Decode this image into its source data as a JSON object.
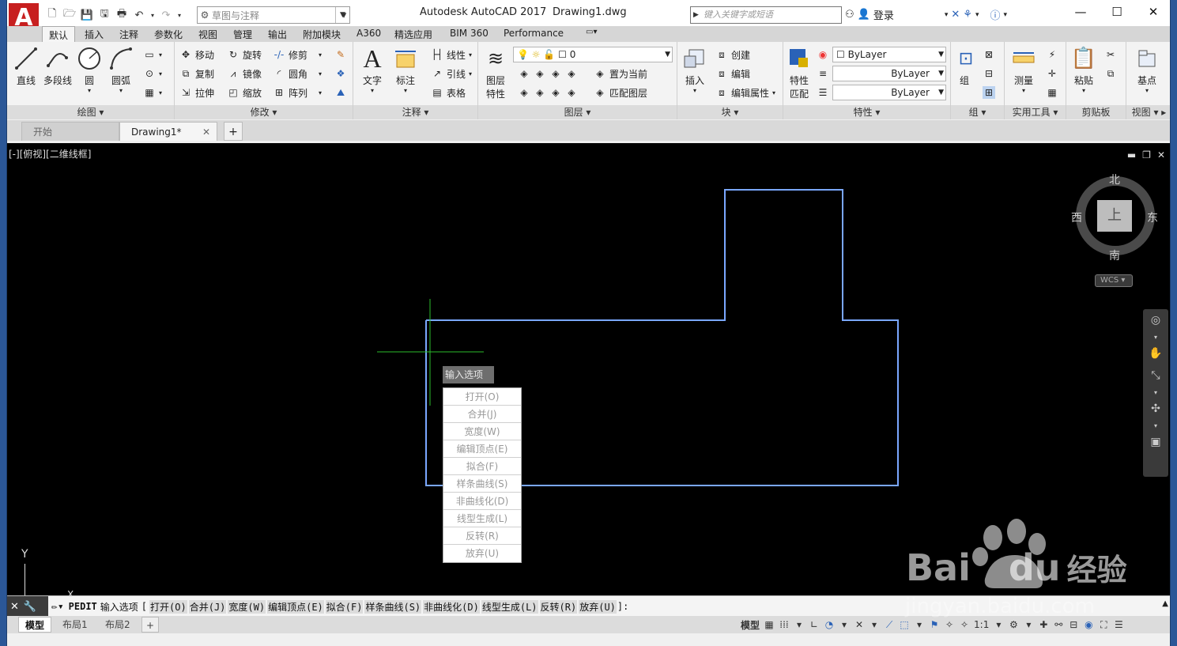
{
  "titlebar": {
    "app_title": "Autodesk AutoCAD 2017",
    "file_name": "Drawing1.dwg",
    "workspace": "草图与注释",
    "search_placeholder": "键入关键字或短语",
    "login": "登录",
    "logo": "A"
  },
  "ribbon_tabs": [
    "默认",
    "插入",
    "注释",
    "参数化",
    "视图",
    "管理",
    "输出",
    "附加模块",
    "A360",
    "精选应用",
    "BIM 360",
    "Performance"
  ],
  "panels": {
    "draw": {
      "title": "绘图",
      "line": "直线",
      "polyline": "多段线",
      "circle": "圆",
      "arc": "圆弧"
    },
    "modify": {
      "title": "修改",
      "move": "移动",
      "rotate": "旋转",
      "trim": "修剪",
      "copy": "复制",
      "mirror": "镜像",
      "fillet": "圆角",
      "stretch": "拉伸",
      "scale": "缩放",
      "array": "阵列"
    },
    "annotation": {
      "title": "注释",
      "text": "文字",
      "dimension": "标注",
      "linear": "线性",
      "leader": "引线",
      "table": "表格"
    },
    "layers": {
      "title": "图层",
      "layer_props_1": "图层",
      "layer_props_2": "特性",
      "current_layer": "0",
      "set_current": "置为当前",
      "match_layer": "匹配图层"
    },
    "block": {
      "title": "块",
      "insert": "插入",
      "create": "创建",
      "edit": "编辑",
      "edit_attr": "编辑属性"
    },
    "properties": {
      "title": "特性",
      "match_1": "特性",
      "match_2": "匹配",
      "color": "ByLayer",
      "linetype": "ByLayer",
      "lineweight": "ByLayer"
    },
    "groups": {
      "title": "组",
      "group": "组"
    },
    "utilities": {
      "title": "实用工具",
      "measure": "测量"
    },
    "clipboard": {
      "title": "剪贴板",
      "paste": "粘贴"
    },
    "view": {
      "title": "视图",
      "base": "基点"
    }
  },
  "doc_tabs": {
    "start": "开始",
    "drawing": "Drawing1*",
    "add": "+"
  },
  "viewport": {
    "label": "[-][俯视][二维线框]",
    "compass": {
      "north": "北",
      "south": "南",
      "east": "东",
      "west": "西",
      "top": "上",
      "wcs": "WCS"
    },
    "ucs_y": "Y",
    "ucs_x": "X"
  },
  "context_menu": {
    "header": "输入选项",
    "items": [
      "打开(O)",
      "合并(J)",
      "宽度(W)",
      "编辑顶点(E)",
      "拟合(F)",
      "样条曲线(S)",
      "非曲线化(D)",
      "线型生成(L)",
      "反转(R)",
      "放弃(U)"
    ]
  },
  "command_line": {
    "command": "PEDIT",
    "prompt": "输入选项",
    "open_bracket": "[",
    "options": [
      "打开(O)",
      "合并(J)",
      "宽度(W)",
      "编辑顶点(E)",
      "拟合(F)",
      "样条曲线(S)",
      "非曲线化(D)",
      "线型生成(L)",
      "反转(R)",
      "放弃(U)"
    ],
    "close": "]:"
  },
  "status_bar": {
    "layouts": [
      "模型",
      "布局1",
      "布局2"
    ],
    "model": "模型",
    "scale": "1:1"
  },
  "watermark": {
    "brand": "Bai",
    "brand2": "du",
    "tagline": "经验",
    "url": "jingyan.baidu.com"
  },
  "colors": {
    "accent": "#2b5797",
    "polyline": "#7aa7ff",
    "crosshair": "#2bbd2b",
    "logo": "#c71f1f"
  }
}
